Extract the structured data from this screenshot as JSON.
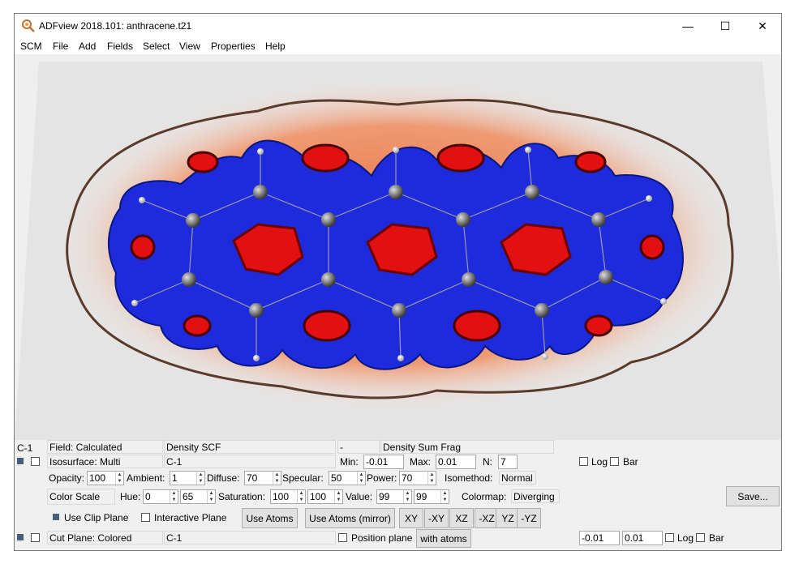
{
  "window": {
    "title": "ADFview 2018.101: anthracene.t21",
    "controls": {
      "minimize": "—",
      "maximize": "☐",
      "close": "✕"
    }
  },
  "menu": [
    "SCM",
    "File",
    "Add",
    "Fields",
    "Select",
    "View",
    "Properties",
    "Help"
  ],
  "field_row": {
    "atom": "C-1",
    "field": "Field: Calculated",
    "field_name": "Density SCF",
    "op": "-",
    "field2": "Density Sum Frag"
  },
  "iso_row": {
    "isosurface": "Isosurface: Multi",
    "source": "C-1",
    "min_label": "Min:",
    "min": "-0.01",
    "max_label": "Max:",
    "max": "0.01",
    "n_label": "N:",
    "n": "7",
    "log_label": "Log",
    "bar_label": "Bar"
  },
  "material_row": {
    "opacity_label": "Opacity:",
    "opacity": "100",
    "ambient_label": "Ambient:",
    "ambient": "1",
    "diffuse_label": "Diffuse:",
    "diffuse": "70",
    "specular_label": "Specular:",
    "specular": "50",
    "power_label": "Power:",
    "power": "70",
    "isomethod_label": "Isomethod:",
    "isomethod": "Normal"
  },
  "color_row": {
    "color_scale": "Color Scale",
    "hue_label": "Hue:",
    "hue_min": "0",
    "hue_max": "65",
    "saturation_label": "Saturation:",
    "sat_min": "100",
    "sat_max": "100",
    "value_label": "Value:",
    "val_min": "99",
    "val_max": "99",
    "colormap_label": "Colormap:",
    "colormap": "Diverging",
    "save_button": "Save..."
  },
  "clip_row": {
    "use_clip": "Use Clip Plane",
    "interactive": "Interactive Plane",
    "use_atoms": "Use Atoms",
    "use_atoms_mirror": "Use Atoms (mirror)",
    "views": [
      "XY",
      "-XY",
      "XZ",
      "-XZ",
      "YZ",
      "-YZ"
    ]
  },
  "cut_row": {
    "cut_plane": "Cut Plane: Colored",
    "source": "C-1",
    "position": "Position plane",
    "with_atoms": "with atoms",
    "min": "-0.01",
    "max": "0.01",
    "log_label": "Log",
    "bar_label": "Bar"
  },
  "colors": {
    "negative_surface": "#1d2bdc",
    "positive_surface": "#e21010",
    "background_plane": "#efefef",
    "cut_plane_glow": "#e8693a"
  },
  "molecule": {
    "name": "anthracene",
    "atoms_c": 14,
    "atoms_h": 10
  }
}
